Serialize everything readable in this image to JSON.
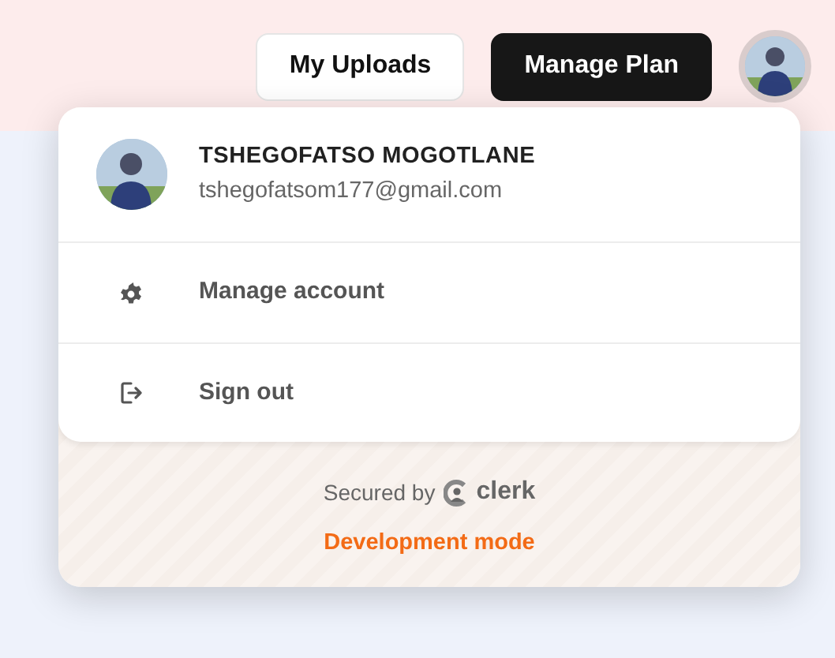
{
  "top_buttons": [
    {
      "label": "My Uploads",
      "kind": "outline"
    },
    {
      "label": "Manage Plan",
      "kind": "dark"
    }
  ],
  "user_menu": {
    "name": "TSHEGOFATSO MOGOTLANE",
    "email": "tshegofatsom177@gmail.com",
    "actions": [
      {
        "label": "Manage account",
        "kind": "settings"
      },
      {
        "label": "Sign out",
        "kind": "signout"
      }
    ],
    "footer": {
      "secured_by": "Secured by",
      "brand": "clerk",
      "mode": "Development mode"
    }
  }
}
